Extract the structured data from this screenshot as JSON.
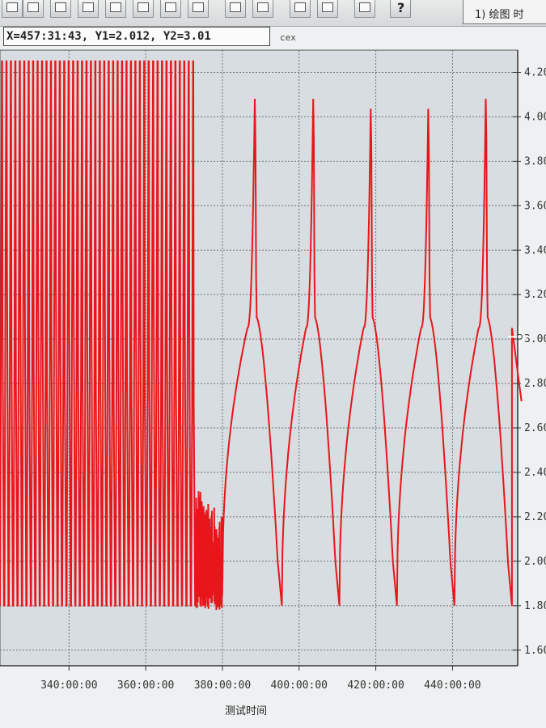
{
  "toolbar": {
    "buttons": [
      "zoom-icon",
      "back-icon",
      "grid-icon",
      "grid-icon",
      "grid-icon",
      "grid-icon",
      "list-icon",
      "copy-icon",
      "list-icon",
      "print-icon",
      "layout-icon",
      "layout-icon",
      "pen-icon",
      "help-icon"
    ],
    "help_label": "?",
    "tab_label": "1) 绘图  时"
  },
  "readout": {
    "text": "X=457:31:43, Y1=2.012, Y2=3.01",
    "suffix": "cex"
  },
  "colors": {
    "series": "#e8161b",
    "plot_bg": "#d7dde0",
    "grid": "#6d7478"
  },
  "chart_data": {
    "type": "line",
    "title": "",
    "xlabel": "测试时间",
    "ylabel": "",
    "xlim": [
      322,
      457
    ],
    "ylim": [
      1.53,
      4.3
    ],
    "x_ticks": [
      340,
      360,
      380,
      400,
      420,
      440
    ],
    "x_tick_labels": [
      "340:00:00",
      "360:00:00",
      "380:00:00",
      "400:00:00",
      "420:00:00",
      "440:00:00"
    ],
    "y_ticks": [
      1.6,
      1.8,
      2.0,
      2.2,
      2.4,
      2.6,
      2.8,
      3.0,
      3.2,
      3.4,
      3.6,
      3.8,
      4.0,
      4.2
    ],
    "y_tick_labels": [
      "1.60",
      "1.80",
      "2.00",
      "2.20",
      "2.40",
      "2.60",
      "2.80",
      "3.00",
      "3.20",
      "3.40",
      "3.60",
      "3.80",
      "4.00",
      "4.20"
    ],
    "grid": true,
    "cursor": {
      "x": 457.5,
      "y": 3.01
    },
    "series": [
      {
        "fast_cycles": {
          "x_start": 322,
          "x_end": 373,
          "count": 44,
          "y_max": 4.25,
          "y_min": 1.8
        },
        "noise": {
          "x_start": 373,
          "x_end": 380,
          "y_max": 2.35,
          "y_min": 1.78
        },
        "slow_cycles": [
          {
            "x_start": 380,
            "x_end": 395.5,
            "y_start": 1.9,
            "y_peak": 4.2,
            "y_min": 1.8
          },
          {
            "x_start": 395.5,
            "x_end": 410.5,
            "y_start": 1.8,
            "y_peak": 4.2,
            "y_min": 1.8
          },
          {
            "x_start": 410.5,
            "x_end": 425.5,
            "y_start": 1.8,
            "y_peak": 4.15,
            "y_min": 1.8
          },
          {
            "x_start": 425.5,
            "x_end": 440.5,
            "y_start": 1.8,
            "y_peak": 4.15,
            "y_min": 1.8
          },
          {
            "x_start": 440.5,
            "x_end": 455.5,
            "y_start": 1.8,
            "y_peak": 4.2,
            "y_min": 1.8
          }
        ],
        "tail": {
          "x_start": 455.5,
          "x_end": 458,
          "y_start": 3.05,
          "y_end": 2.72
        }
      }
    ]
  }
}
